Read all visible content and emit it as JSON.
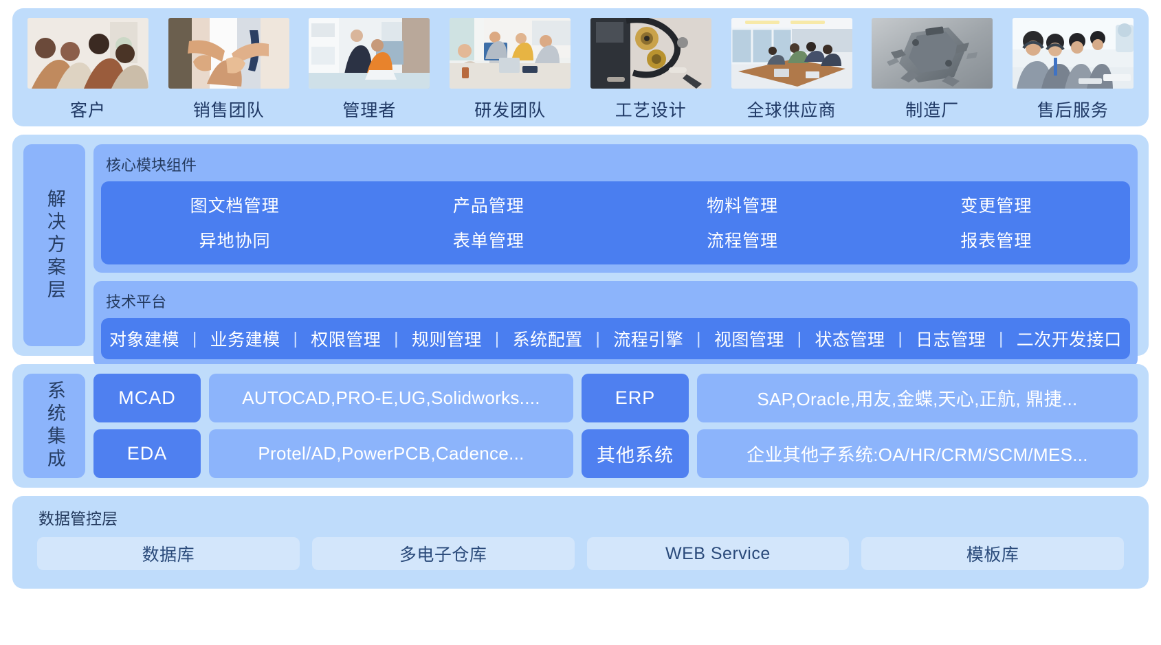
{
  "stakeholders": {
    "items": [
      {
        "label": "客户",
        "photo": "handshake-meeting-photo"
      },
      {
        "label": "销售团队",
        "photo": "team-hands-together-photo"
      },
      {
        "label": "管理者",
        "photo": "manager-office-photo"
      },
      {
        "label": "研发团队",
        "photo": "rnd-team-desks-photo"
      },
      {
        "label": "工艺设计",
        "photo": "mechanical-parts-photo"
      },
      {
        "label": "全球供应商",
        "photo": "conference-room-photo"
      },
      {
        "label": "制造厂",
        "photo": "car-chassis-render-photo"
      },
      {
        "label": "售后服务",
        "photo": "call-center-photo"
      }
    ]
  },
  "solution": {
    "side_label": "解决方案层",
    "core_modules": {
      "title": "核心模块组件",
      "items": [
        "图文档管理",
        "产品管理",
        "物料管理",
        "变更管理",
        "异地协同",
        "表单管理",
        "流程管理",
        "报表管理"
      ]
    },
    "tech_platform": {
      "title": "技术平台",
      "items": [
        "对象建模",
        "业务建模",
        "权限管理",
        "规则管理",
        "系统配置",
        "流程引擎",
        "视图管理",
        "状态管理",
        "日志管理",
        "二次开发接口"
      ],
      "separator": "|"
    }
  },
  "integration": {
    "side_label": "系统集成",
    "rows": [
      {
        "key": "MCAD",
        "value": "AUTOCAD,PRO-E,UG,Solidworks...."
      },
      {
        "key": "ERP",
        "value": "SAP,Oracle,用友,金蝶,天心,正航, 鼎捷..."
      },
      {
        "key": "EDA",
        "value": "Protel/AD,PowerPCB,Cadence..."
      },
      {
        "key": "其他系统",
        "value": "企业其他子系统:OA/HR/CRM/SCM/MES..."
      }
    ]
  },
  "data_layer": {
    "title": "数据管控层",
    "items": [
      "数据库",
      "多电子仓库",
      "WEB Service",
      "模板库"
    ]
  },
  "colors": {
    "page_bg": "#ffffff",
    "panel_bg": "#bfdcfb",
    "panel_bg_mid": "#8cb4fb",
    "accent_dark": "#4a7ef0",
    "chip_light": "#d3e6fb",
    "text_dark": "#243a5e",
    "text_light": "#ffffff"
  }
}
